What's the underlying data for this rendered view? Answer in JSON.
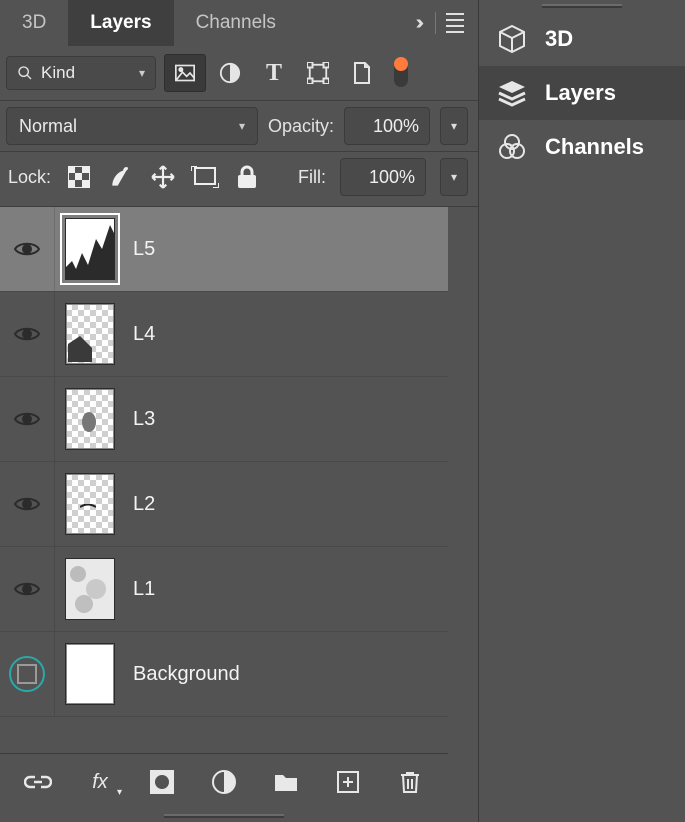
{
  "tabs": {
    "t0": "3D",
    "t1": "Layers",
    "t2": "Channels",
    "activeIndex": 1
  },
  "filter": {
    "kind_label": "Kind"
  },
  "blend": {
    "mode": "Normal",
    "opacity_label": "Opacity:",
    "opacity_value": "100%"
  },
  "lock": {
    "label": "Lock:",
    "fill_label": "Fill:",
    "fill_value": "100%"
  },
  "layers": {
    "l0": "L5",
    "l1": "L4",
    "l2": "L3",
    "l3": "L2",
    "l4": "L1",
    "bg": "Background"
  },
  "dock": {
    "d0": "3D",
    "d1": "Layers",
    "d2": "Channels",
    "activeIndex": 1
  },
  "colors": {
    "accent": "#ff7a3d",
    "select_bg": "#7e7e7e",
    "ring": "#2aa9a9"
  }
}
